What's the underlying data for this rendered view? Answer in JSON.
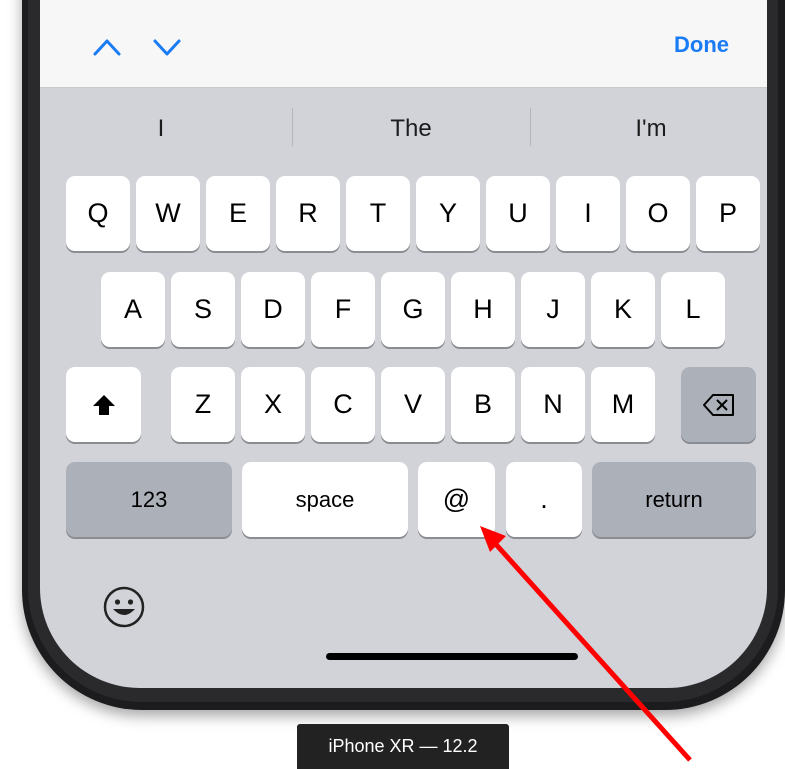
{
  "toolbar": {
    "done_label": "Done",
    "prev_icon": "chevron-up-icon",
    "next_icon": "chevron-down-icon"
  },
  "predictions": [
    "I",
    "The",
    "I'm"
  ],
  "keyboard": {
    "row1": [
      "Q",
      "W",
      "E",
      "R",
      "T",
      "Y",
      "U",
      "I",
      "O",
      "P"
    ],
    "row2": [
      "A",
      "S",
      "D",
      "F",
      "G",
      "H",
      "J",
      "K",
      "L"
    ],
    "row3": [
      "Z",
      "X",
      "C",
      "V",
      "B",
      "N",
      "M"
    ],
    "shift_icon": "shift-icon",
    "delete_icon": "delete-backspace-icon",
    "numbers_label": "123",
    "space_label": "space",
    "at_label": "@",
    "period_label": ".",
    "return_label": "return",
    "emoji_icon": "emoji-icon"
  },
  "device_label": "iPhone XR — 12.2",
  "colors": {
    "accent": "#1a7cf5",
    "keyboard_bg": "#d1d3d9",
    "key_light": "#ffffff",
    "key_dark": "#acb0b9",
    "arrow": "#ff0000"
  }
}
